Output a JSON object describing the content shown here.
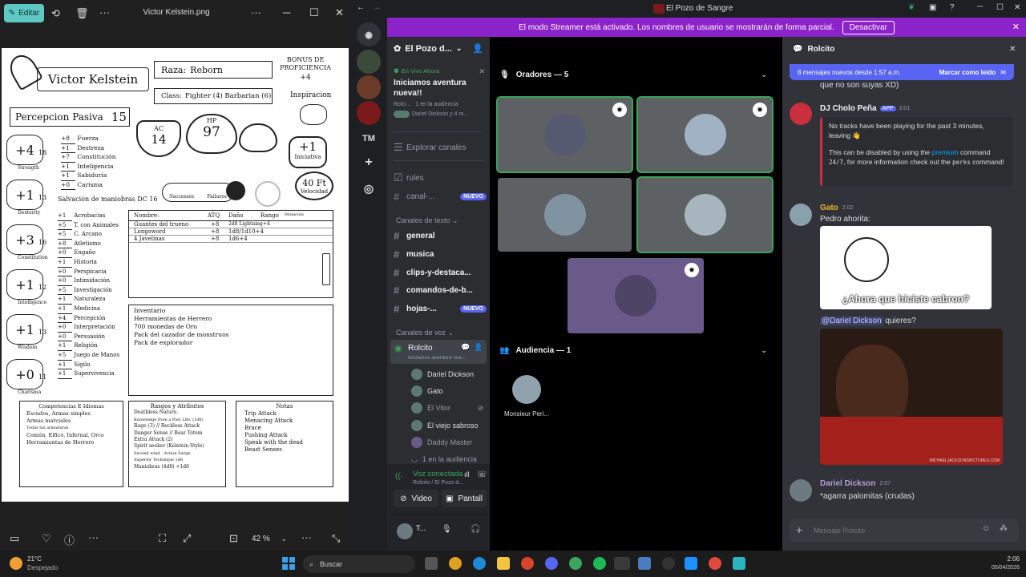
{
  "viewer": {
    "edit_label": "Editar",
    "file_name": "Victor Kelstein.png",
    "zoom": "42 %",
    "sheet": {
      "name": "Victor Kelstein",
      "raza_label": "Raza:",
      "raza": "Reborn",
      "class_label": "Class:",
      "class": "Fighter (4) Barbarian (6)",
      "bonus_label": "BONUS DE PROFICIENCIA",
      "bonus": "+4",
      "inspiracion": "Inspiracion",
      "percepcion_label": "Percepcion Pasiva",
      "percepcion": "15",
      "ac_label": "AC",
      "ac": "14",
      "hp_label": "HP",
      "hp": "97",
      "iniciativa_value": "+1",
      "iniciativa_label": "Iniciativa",
      "velocidad_value": "40 Ft",
      "velocidad_label": "Velocidad",
      "salvacion": "Salvación de maniobras DC 16",
      "successes": "Successes",
      "failures": "Failures",
      "abilities": [
        {
          "mod": "+4",
          "score": "18",
          "label": "Strength"
        },
        {
          "mod": "+1",
          "score": "13",
          "label": "Dexterity"
        },
        {
          "mod": "+3",
          "score": "16",
          "label": "Constitution"
        },
        {
          "mod": "+1",
          "score": "12",
          "label": "Intelligence"
        },
        {
          "mod": "+1",
          "score": "13",
          "label": "Wisdom"
        },
        {
          "mod": "+0",
          "score": "11",
          "label": "Charisma"
        }
      ],
      "saves": [
        {
          "val": "+8",
          "name": "Fuerza"
        },
        {
          "val": "+1",
          "name": "Destreza"
        },
        {
          "val": "+7",
          "name": "Constitución"
        },
        {
          "val": "+1",
          "name": "Inteligencia"
        },
        {
          "val": "+1",
          "name": "Sabiduría"
        },
        {
          "val": "+0",
          "name": "Carisma"
        }
      ],
      "skills": [
        {
          "val": "+1",
          "name": "Acrobacias"
        },
        {
          "val": "+5",
          "name": "T. con Animales"
        },
        {
          "val": "+5",
          "name": "C. Arcano"
        },
        {
          "val": "+8",
          "name": "Atletismo"
        },
        {
          "val": "+0",
          "name": "Engaño"
        },
        {
          "val": "+1",
          "name": "Historia"
        },
        {
          "val": "+0",
          "name": "Perspicacia"
        },
        {
          "val": "+0",
          "name": "Intimidación"
        },
        {
          "val": "+5",
          "name": "Investigación"
        },
        {
          "val": "+1",
          "name": "Naturaleza"
        },
        {
          "val": "+1",
          "name": "Medicina"
        },
        {
          "val": "+4",
          "name": "Percepción"
        },
        {
          "val": "+0",
          "name": "Interpretación"
        },
        {
          "val": "+0",
          "name": "Persuasión"
        },
        {
          "val": "+1",
          "name": "Religión"
        },
        {
          "val": "+5",
          "name": "Juego de Manos"
        },
        {
          "val": "+1",
          "name": "Sigilo"
        },
        {
          "val": "+1",
          "name": "Supervivencia"
        }
      ],
      "attack_headers": [
        "Nombre:",
        "ATQ",
        "Daño",
        "Rango",
        "Munición"
      ],
      "attacks": [
        {
          "name": "Guantes del trueno",
          "atq": "+8",
          "dmg": "2d8 Lightning+4"
        },
        {
          "name": "Longsword",
          "atq": "+8",
          "dmg": "1d8/1d10+4"
        },
        {
          "name": "4 Javelinas",
          "atq": "+8",
          "dmg": "1d6+4"
        }
      ],
      "inventory_title": "Inventario",
      "inventory": [
        "Herramientas de Herrero",
        "700 monedas de Oro",
        "Pack del cazador de monstruos",
        "Pack de explorador"
      ],
      "comp_title": "Competencias E Idiomas",
      "comp": [
        "Escudos, Armas simples",
        "Armas marciales",
        "Todas las armaduras",
        "Común, Elfico, Infernal, Orco",
        "Herramientas de Herrero"
      ],
      "rasgos_title": "Rasgos y Atributos",
      "rasgos": [
        "Deathless Nature.",
        "Knowledge from a Past Life. (1d6)",
        "Rage (3) // Reckless Attack",
        "Danger Sense // Bear Totem",
        "Extra Attack (2)",
        "Spirit seeker (Kelstein Style)",
        "Second wind",
        "Action Surge",
        "Superior Technique 1d6",
        "Maniobras (4d8) +1d6"
      ],
      "notas_title": "Notas",
      "notas": [
        "Trip Attack",
        "Menacing Attack",
        "Brace",
        "Pushing Attack",
        "Speak with the dead",
        "Beast Senses"
      ]
    }
  },
  "discord": {
    "window_title": "El Pozo de Sangre",
    "streamer_text": "El modo Streamer está activado. Los nombres de usuario se mostrarán de forma parcial.",
    "streamer_button": "Desactivar",
    "servers": [
      "TM"
    ],
    "server_name": "El Pozo d...",
    "live_label": "En Vivo Ahora",
    "live_title": "Iniciamos aventura nueva!!",
    "live_channel": "Rolci...",
    "live_audience": "1 en la audiencia",
    "live_speakers": "Dariel Dickson y 4 m...",
    "explore": "Explorar canales",
    "channels_top": [
      {
        "name": "rules",
        "badge": ""
      },
      {
        "name": "canal-...",
        "badge": "NUEVO"
      }
    ],
    "text_category": "Canales de texto",
    "text_channels": [
      {
        "name": "general",
        "badge": ""
      },
      {
        "name": "musica",
        "badge": ""
      },
      {
        "name": "clips-y-destaca...",
        "badge": ""
      },
      {
        "name": "comandos-de-b...",
        "badge": ""
      },
      {
        "name": "hojas-...",
        "badge": "NUEVO"
      }
    ],
    "voice_category": "Canales de voz",
    "voice_channel": "Rolcito",
    "voice_channel_sub": "Iniciamos aventura nue...",
    "voice_users": [
      "Dariel Dickson",
      "Gato",
      "El Vitor",
      "El viejo sabroso",
      "Daddy Master"
    ],
    "voice_audience": "1 en la audiencia",
    "voice_connected": "Voz conectada",
    "voice_connected_sub": "Rolcito / El Pozo d...",
    "video_button": "Video",
    "screen_button": "Pantall",
    "user_short": "T...",
    "speakers_header": "Oradores — 5",
    "audience_header": "Audiencia — 1",
    "audience_member": "Monsieur Peri...",
    "chat": {
      "channel": "Rolcito",
      "new_messages": "8 mensajes nuevos desde 1:57 a.m.",
      "mark_read": "Marcar como leído",
      "prev_line": "que no son suyas XD)",
      "bot_name": "DJ Cholo Peña",
      "bot_tag": "APP",
      "bot_time": "2:01",
      "bot_line1": "No tracks have been playing for the past 3 minutes, leaving 👋",
      "bot_line2_a": "This can be disabled by using the",
      "bot_line2_premium": "premium",
      "bot_line2_b": "command",
      "bot_line2_code": "24/7",
      "bot_line2_c": ", for more information check out the",
      "bot_line2_code2": "perks",
      "bot_line2_d": "command!",
      "gato_name": "Gato",
      "gato_time": "2:02",
      "gato_text": "Pedro ahorita:",
      "meme_caption": "¿Ahora que hiciste cabron?",
      "mention": "@Dariel Dickson",
      "mention_text": "quieres?",
      "gif_watermark": "MICHAELJACKSONSPICTURES.COM",
      "dariel_name": "Dariel Dickson",
      "dariel_time": "2:07",
      "dariel_text": "*agarra palomitas (crudas)",
      "input_placeholder": "Mensaje Rolcito"
    }
  },
  "taskbar": {
    "weather_temp": "21°C",
    "weather_desc": "Despejado",
    "search": "Buscar",
    "time": "2:06",
    "date": "05/04/2026"
  },
  "colors": {
    "blurple": "#5865f2",
    "streamer": "#8c22c9",
    "speaking": "#3ba55d",
    "edit": "#5ec8c4"
  }
}
